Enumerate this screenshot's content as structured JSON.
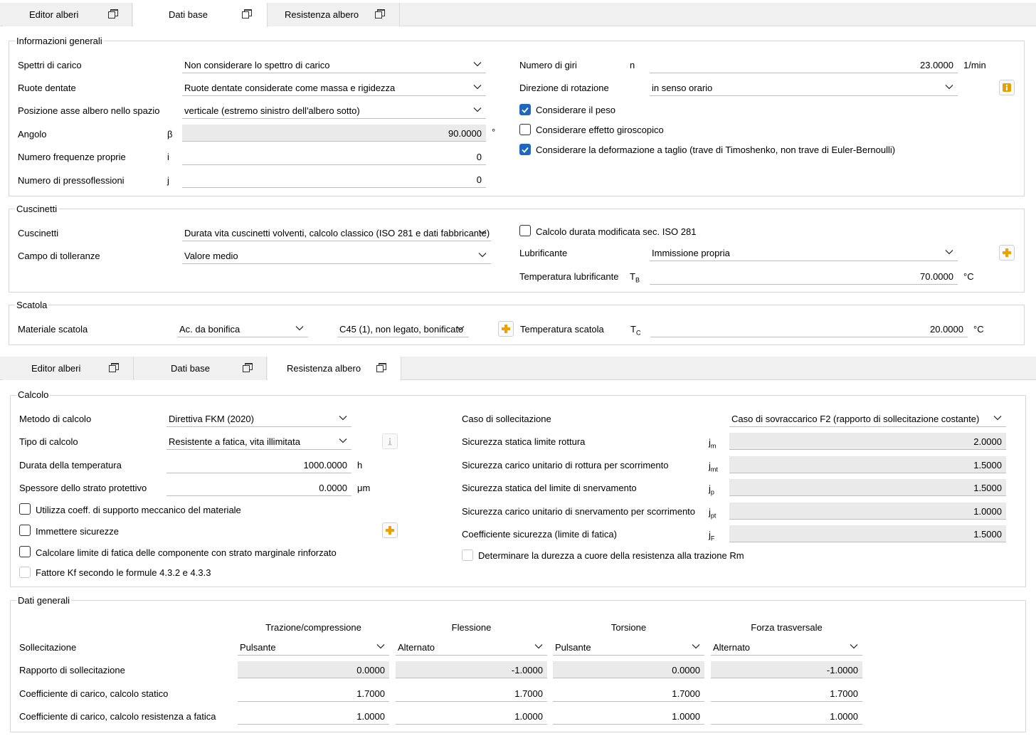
{
  "top_tabs": [
    {
      "label": "Editor alberi",
      "active": false
    },
    {
      "label": "Dati base",
      "active": true
    },
    {
      "label": "Resistenza albero",
      "active": false
    }
  ],
  "general_info": {
    "title": "Informazioni generali",
    "load_spectra": {
      "label": "Spettri di carico",
      "value": "Non considerare lo spettro di carico"
    },
    "gears": {
      "label": "Ruote dentate",
      "value": "Ruote dentate considerate come massa e rigidezza"
    },
    "axis_position": {
      "label": "Posizione asse albero nello spazio",
      "value": "verticale (estremo sinistro dell'albero sotto)"
    },
    "angle": {
      "label": "Angolo",
      "symbol": "β",
      "value": "90.0000",
      "unit": "°"
    },
    "eigenfrequencies": {
      "label": "Numero frequenze proprie",
      "symbol": "i",
      "value": "0"
    },
    "buckling": {
      "label": "Numero di pressoflessioni",
      "symbol": "j",
      "value": "0"
    },
    "speed": {
      "label": "Numero di giri",
      "symbol": "n",
      "value": "23.0000",
      "unit": "1/min"
    },
    "rotation": {
      "label": "Direzione di rotazione",
      "value": "in senso orario"
    },
    "cb_weight": {
      "label": "Considerare il peso",
      "checked": true
    },
    "cb_gyro": {
      "label": "Considerare effetto giroscopico",
      "checked": false
    },
    "cb_shear": {
      "label": "Considerare la deformazione a taglio (trave di Timoshenko, non trave di Euler-Bernoulli)",
      "checked": true
    }
  },
  "bearings": {
    "title": "Cuscinetti",
    "bearings": {
      "label": "Cuscinetti",
      "value": "Durata vita cuscinetti volventi, calcolo classico (ISO 281 e dati fabbricante)"
    },
    "tolerance": {
      "label": "Campo di tolleranze",
      "value": "Valore medio"
    },
    "cb_modified": {
      "label": "Calcolo durata modificata sec. ISO 281",
      "checked": false
    },
    "lubricant": {
      "label": "Lubrificante",
      "value": "Immissione propria"
    },
    "lub_temp": {
      "label": "Temperatura lubrificante",
      "symbol": "T",
      "symbol_sub": "B",
      "value": "70.0000",
      "unit": "°C"
    }
  },
  "housing": {
    "title": "Scatola",
    "material_label": "Materiale scatola",
    "material_type": "Ac. da bonifica",
    "material": "C45 (1), non legato, bonificato",
    "temp_label": "Temperatura scatola",
    "temp_symbol": "T",
    "temp_sub": "C",
    "temp_value": "20.0000",
    "temp_unit": "°C"
  },
  "bottom_tabs": [
    {
      "label": "Editor alberi",
      "active": false
    },
    {
      "label": "Dati base",
      "active": false
    },
    {
      "label": "Resistenza albero",
      "active": true
    }
  ],
  "calculation": {
    "title": "Calcolo",
    "method": {
      "label": "Metodo di calcolo",
      "value": "Direttiva FKM (2020)"
    },
    "calc_type": {
      "label": "Tipo di calcolo",
      "value": "Resistente a fatica, vita illimitata"
    },
    "temp_duration": {
      "label": "Durata della temperatura",
      "value": "1000.0000",
      "unit": "h"
    },
    "layer": {
      "label": "Spessore dello strato protettivo",
      "value": "0.0000",
      "unit": "μm"
    },
    "cb_support": {
      "label": "Utilizza coeff. di supporto meccanico del materiale",
      "checked": false
    },
    "cb_safeties": {
      "label": "Immettere sicurezze",
      "checked": false
    },
    "cb_surface": {
      "label": "Calcolare limite di fatica delle componente con strato marginale rinforzato",
      "checked": false
    },
    "cb_kf": {
      "label": "Fattore Kf secondo le formule 4.3.2 e 4.3.3",
      "checked": false
    },
    "load_case": {
      "label": "Caso di sollecitazione",
      "value": "Caso di sovraccarico F2 (rapporto di sollecitazione costante)"
    },
    "safety_rows": [
      {
        "label": "Sicurezza statica limite rottura",
        "symbol": "j",
        "sub": "m",
        "value": "2.0000"
      },
      {
        "label": "Sicurezza carico unitario di rottura per scorrimento",
        "symbol": "j",
        "sub": "mt",
        "value": "1.5000"
      },
      {
        "label": "Sicurezza statica del limite di snervamento",
        "symbol": "j",
        "sub": "p",
        "value": "1.5000"
      },
      {
        "label": "Sicurezza carico unitario di snervamento per scorrimento",
        "symbol": "j",
        "sub": "pt",
        "value": "1.0000"
      },
      {
        "label": "Coefficiente sicurezza (limite di fatica)",
        "symbol": "j",
        "sub": "F",
        "value": "1.5000"
      }
    ],
    "cb_hardness": {
      "label": "Determinare la durezza a cuore della resistenza alla trazione Rm",
      "checked": false
    }
  },
  "general_data": {
    "title": "Dati generali",
    "columns": [
      "Trazione/compressione",
      "Flessione",
      "Torsione",
      "Forza trasversale"
    ],
    "row_labels": [
      "Sollecitazione",
      "Rapporto di sollecitazione",
      "Coefficiente di carico, calcolo statico",
      "Coefficiente di carico, calcolo resistenza a fatica"
    ],
    "stress": [
      "Pulsante",
      "Alternato",
      "Pulsante",
      "Alternato"
    ],
    "ratio": [
      "0.0000",
      "-1.0000",
      "0.0000",
      "-1.0000"
    ],
    "static": [
      "1.7000",
      "1.7000",
      "1.7000",
      "1.7000"
    ],
    "fatigue": [
      "1.0000",
      "1.0000",
      "1.0000",
      "1.0000"
    ]
  },
  "colors": {
    "checkbox_accent": "#1f66c1",
    "plus_icon": "#f0a000",
    "info_icon": "#e6a100"
  }
}
